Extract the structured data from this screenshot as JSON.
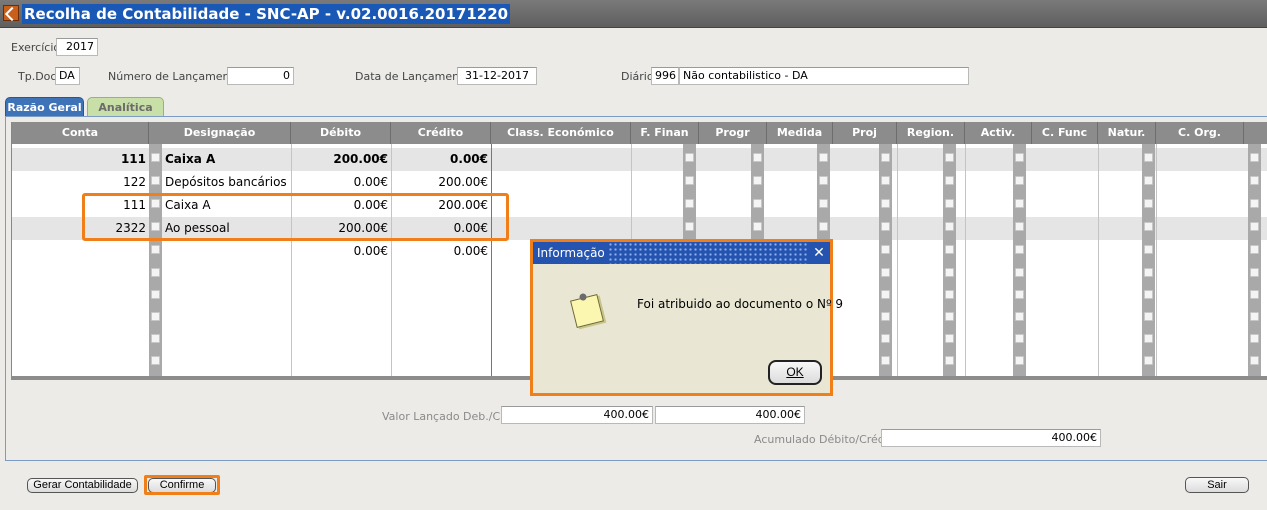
{
  "window": {
    "title": "Recolha de Contabilidade - SNC-AP - v.02.0016.20171220"
  },
  "header": {
    "exercicio_label": "Exercício",
    "exercicio_value": "2017",
    "tpdoc_label": "Tp.Doc.",
    "tpdoc_value": "DA",
    "num_lanc_label": "Número de Lançamento:",
    "num_lanc_value": "0",
    "data_lanc_label": "Data de Lançamento:",
    "data_lanc_value": "31-12-2017",
    "diario_label": "Diário:",
    "diario_code": "996",
    "diario_desc": "Não contabilistico - DA"
  },
  "tabs": [
    {
      "label": "Razão Geral",
      "active": true
    },
    {
      "label": "Analítica",
      "active": false
    }
  ],
  "grid": {
    "columns": [
      "Conta",
      "Designação",
      "Débito",
      "Crédito",
      "Class. Económico",
      "F. Finan",
      "Progr",
      "Medida",
      "Proj",
      "Region.",
      "Activ.",
      "C. Func",
      "Natur.",
      "C. Org."
    ],
    "rows": [
      {
        "conta": "111",
        "designacao": "Caixa A",
        "debito": "200.00€",
        "credito": "0.00€",
        "bold": true
      },
      {
        "conta": "122",
        "designacao": "Depósitos bancários a",
        "debito": "0.00€",
        "credito": "200.00€"
      },
      {
        "conta": "111",
        "designacao": "Caixa A",
        "debito": "0.00€",
        "credito": "200.00€"
      },
      {
        "conta": "2322",
        "designacao": "Ao pessoal",
        "debito": "200.00€",
        "credito": "0.00€"
      },
      {
        "conta": "",
        "designacao": "",
        "debito": "0.00€",
        "credito": "0.00€"
      }
    ]
  },
  "totals": {
    "valor_lancado_label": "Valor Lançado Deb./Cre.",
    "valor_debito": "400.00€",
    "valor_credito": "400.00€",
    "acumulado_label": "Acumulado Débito/Crédito:",
    "acumulado_value": "400.00€"
  },
  "buttons": {
    "gerar": "Gerar Contabilidade",
    "confirme": "Confirme",
    "sair": "Sair"
  },
  "dialog": {
    "title": "Informação",
    "close": "✕",
    "message": "Foi atribuido ao documento o Nº 9",
    "ok": "OK",
    "icon": "note-icon"
  },
  "colors": {
    "title_bg": "#1a58b6",
    "highlight": "#f07f1a",
    "tab_active": "#3f73b8"
  }
}
